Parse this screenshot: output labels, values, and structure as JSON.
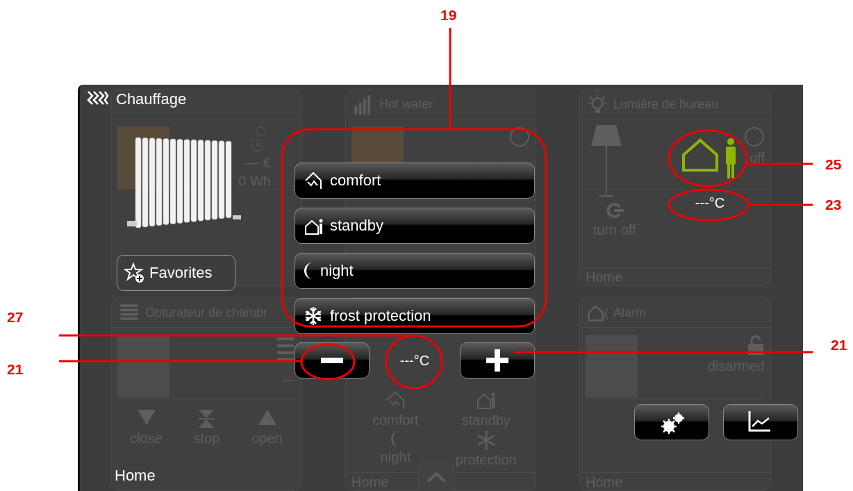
{
  "screen": {
    "background_tiles": [
      {
        "kind": "heating",
        "values": [
          "— €",
          "0 Wh"
        ]
      },
      {
        "kind": "hotwater",
        "title": "Hot water"
      },
      {
        "kind": "light",
        "title": "Lumière de bureau",
        "state": "off",
        "actions": [
          "turn off"
        ],
        "footer": "Home"
      },
      {
        "kind": "shutter",
        "title": "Obturateur de chambr",
        "reading": "---",
        "actions": [
          "close",
          "stop",
          "open"
        ]
      },
      {
        "kind": "modes",
        "actions": [
          "comfort",
          "standby",
          "night",
          "protection"
        ],
        "footer": "Home"
      },
      {
        "kind": "alarm",
        "title": "Alarm",
        "state": "disarmed",
        "footer": "Home"
      }
    ],
    "panel": {
      "title": "Chauffage",
      "favorites_button": "Favorites",
      "modes": [
        {
          "kind": "comfort",
          "label": "comfort"
        },
        {
          "kind": "standby",
          "label": "standby"
        },
        {
          "kind": "night",
          "label": "night"
        },
        {
          "kind": "frost",
          "label": "frost protection"
        }
      ],
      "setpoint": "---°C",
      "status": {
        "kind": "standby",
        "temperature": "---°C"
      },
      "tools": [
        {
          "kind": "settings"
        },
        {
          "kind": "chart"
        }
      ],
      "location": "Home"
    }
  },
  "callouts": [
    {
      "label": "19"
    },
    {
      "label": "25"
    },
    {
      "label": "23"
    },
    {
      "label": "27"
    },
    {
      "label": "21"
    },
    {
      "label": "21"
    }
  ]
}
